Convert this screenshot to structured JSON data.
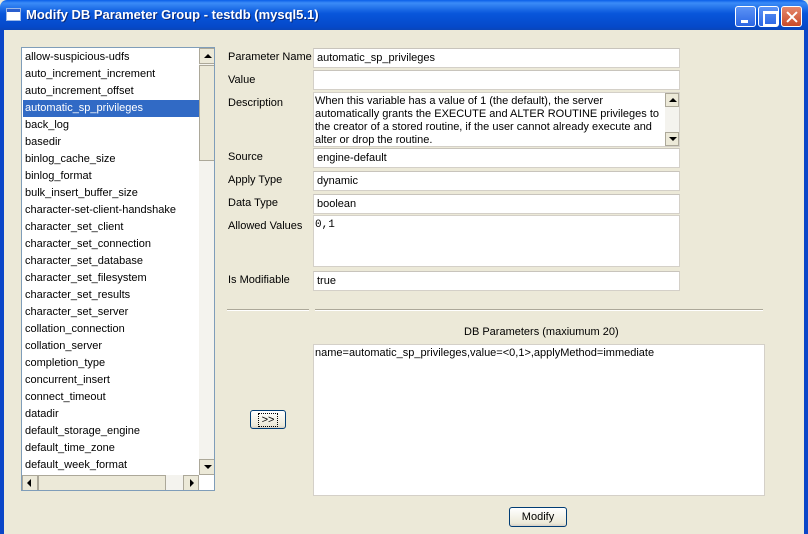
{
  "window": {
    "title": "Modify DB Parameter Group - testdb (mysql5.1)"
  },
  "parameter_list": {
    "selected_index": 3,
    "items": [
      "allow-suspicious-udfs",
      "auto_increment_increment",
      "auto_increment_offset",
      "automatic_sp_privileges",
      "back_log",
      "basedir",
      "binlog_cache_size",
      "binlog_format",
      "bulk_insert_buffer_size",
      "character-set-client-handshake",
      "character_set_client",
      "character_set_connection",
      "character_set_database",
      "character_set_filesystem",
      "character_set_results",
      "character_set_server",
      "collation_connection",
      "collation_server",
      "completion_type",
      "concurrent_insert",
      "connect_timeout",
      "datadir",
      "default_storage_engine",
      "default_time_zone",
      "default_week_format"
    ]
  },
  "form": {
    "parameter_name_label": "Parameter Name",
    "parameter_name": "automatic_sp_privileges",
    "value_label": "Value",
    "value": "",
    "description_label": "Description",
    "description": "When this variable has a value of 1 (the default), the server automatically grants the EXECUTE and ALTER ROUTINE privileges to the creator of a stored routine, if the user cannot already execute and alter or drop the routine.",
    "source_label": "Source",
    "source": "engine-default",
    "apply_type_label": "Apply Type",
    "apply_type": "dynamic",
    "data_type_label": "Data Type",
    "data_type": "boolean",
    "allowed_values_label": "Allowed Values",
    "allowed_values": "0,1",
    "is_modifiable_label": "Is Modifiable",
    "is_modifiable": "true"
  },
  "db_parameters": {
    "label": "DB Parameters (maxiumum 20)",
    "entries": "name=automatic_sp_privileges,value=<0,1>,applyMethod=immediate"
  },
  "buttons": {
    "add_label": ">>",
    "modify_label": "Modify"
  }
}
